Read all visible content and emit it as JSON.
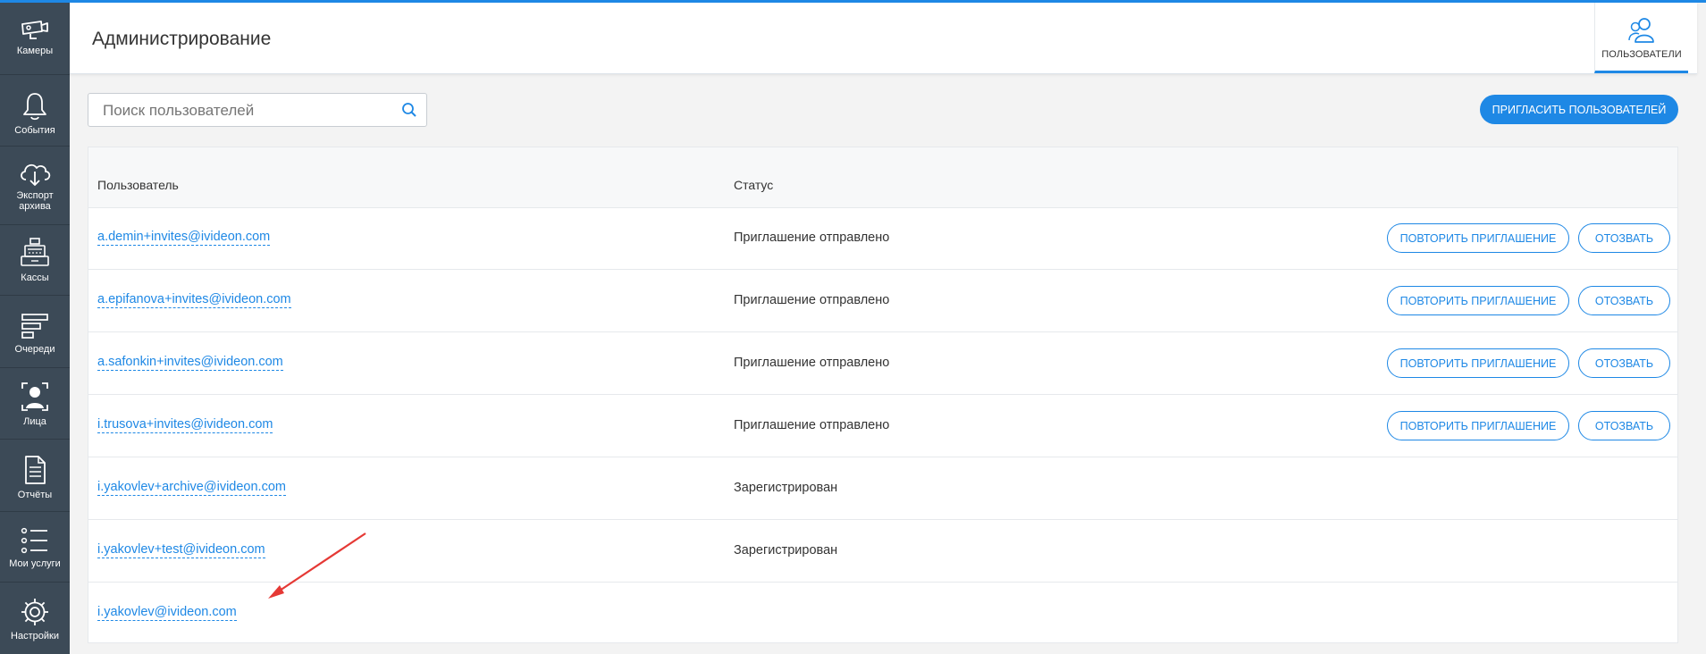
{
  "sidebar": {
    "items": [
      {
        "icon": "camera-icon",
        "label": "Камеры"
      },
      {
        "icon": "bell-icon",
        "label": "События"
      },
      {
        "icon": "cloud-download-icon",
        "label": "Экспорт архива"
      },
      {
        "icon": "cash-register-icon",
        "label": "Кассы"
      },
      {
        "icon": "queue-icon",
        "label": "Очереди"
      },
      {
        "icon": "face-icon",
        "label": "Лица"
      },
      {
        "icon": "report-icon",
        "label": "Отчёты"
      },
      {
        "icon": "list-icon",
        "label": "Мои услуги"
      },
      {
        "icon": "gear-icon",
        "label": "Настройки"
      }
    ]
  },
  "header": {
    "title": "Администрирование",
    "tab": {
      "icon": "users-icon",
      "label": "ПОЛЬЗОВАТЕЛИ"
    }
  },
  "search": {
    "placeholder": "Поиск пользователей",
    "value": "",
    "icon": "search-icon"
  },
  "invite_button": "ПРИГЛАСИТЬ ПОЛЬЗОВАТЕЛЕЙ",
  "table": {
    "columns": {
      "user": "Пользователь",
      "status": "Статус"
    },
    "rows": [
      {
        "email": "a.demin+invites@ivideon.com",
        "status": "Приглашение отправлено",
        "resend": "ПОВТОРИТЬ ПРИГЛАШЕНИЕ",
        "revoke": "ОТОЗВАТЬ"
      },
      {
        "email": "a.epifanova+invites@ivideon.com",
        "status": "Приглашение отправлено",
        "resend": "ПОВТОРИТЬ ПРИГЛАШЕНИЕ",
        "revoke": "ОТОЗВАТЬ"
      },
      {
        "email": "a.safonkin+invites@ivideon.com",
        "status": "Приглашение отправлено",
        "resend": "ПОВТОРИТЬ ПРИГЛАШЕНИЕ",
        "revoke": "ОТОЗВАТЬ"
      },
      {
        "email": "i.trusova+invites@ivideon.com",
        "status": "Приглашение отправлено",
        "resend": "ПОВТОРИТЬ ПРИГЛАШЕНИЕ",
        "revoke": "ОТОЗВАТЬ"
      },
      {
        "email": "i.yakovlev+archive@ivideon.com",
        "status": "Зарегистрирован"
      },
      {
        "email": "i.yakovlev+test@ivideon.com",
        "status": "Зарегистрирован"
      },
      {
        "email": "i.yakovlev@ivideon.com",
        "status": ""
      }
    ]
  },
  "colors": {
    "accent": "#1e88e5",
    "sidebar_bg": "#3c4a57",
    "annotation_arrow": "#e53935"
  }
}
